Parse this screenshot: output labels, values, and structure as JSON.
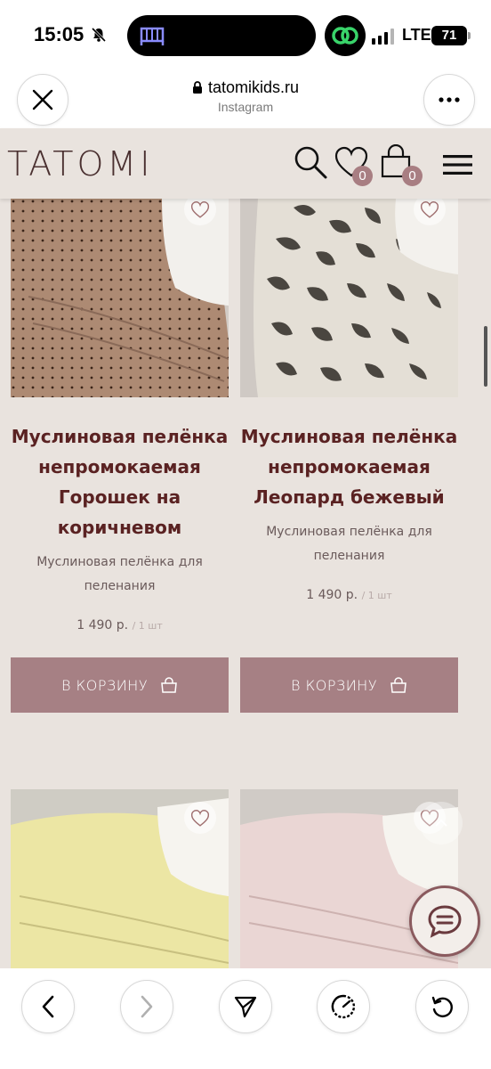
{
  "status_bar": {
    "time": "15:05",
    "network": "LTE",
    "battery": "71"
  },
  "browser": {
    "domain": "tatomikids.ru",
    "source": "Instagram",
    "icons": [
      "close-icon",
      "more-icon",
      "lock-icon"
    ]
  },
  "site_header": {
    "logo": "TATOMI",
    "favorites_count": "0",
    "cart_count": "0",
    "icons": [
      "search-icon",
      "heart-icon",
      "shopping-bag-icon",
      "hamburger-menu-icon"
    ]
  },
  "products": [
    {
      "title": "Муслиновая пелёнка непромокаемая Горошек на коричневом",
      "description": "Муслиновая пелёнка для пеленания",
      "price": "1 490 р.",
      "unit": "/ 1 шт",
      "button": "В КОРЗИНУ",
      "fabric_color": "#b08c74"
    },
    {
      "title": "Муслиновая пелёнка непромокаемая Леопард бежевый",
      "description": "Муслиновая пелёнка для пеленания",
      "price": "1 490 р.",
      "unit": "/ 1 шт",
      "button": "В КОРЗИНУ",
      "fabric_color": "#ddd6cc"
    },
    {
      "fabric_color": "#ede7a6"
    },
    {
      "fabric_color": "#ecd8d6"
    }
  ],
  "colors": {
    "background": "#e9e3de",
    "button": "#a68084",
    "title": "#5a2222",
    "badge": "#a87e82"
  }
}
